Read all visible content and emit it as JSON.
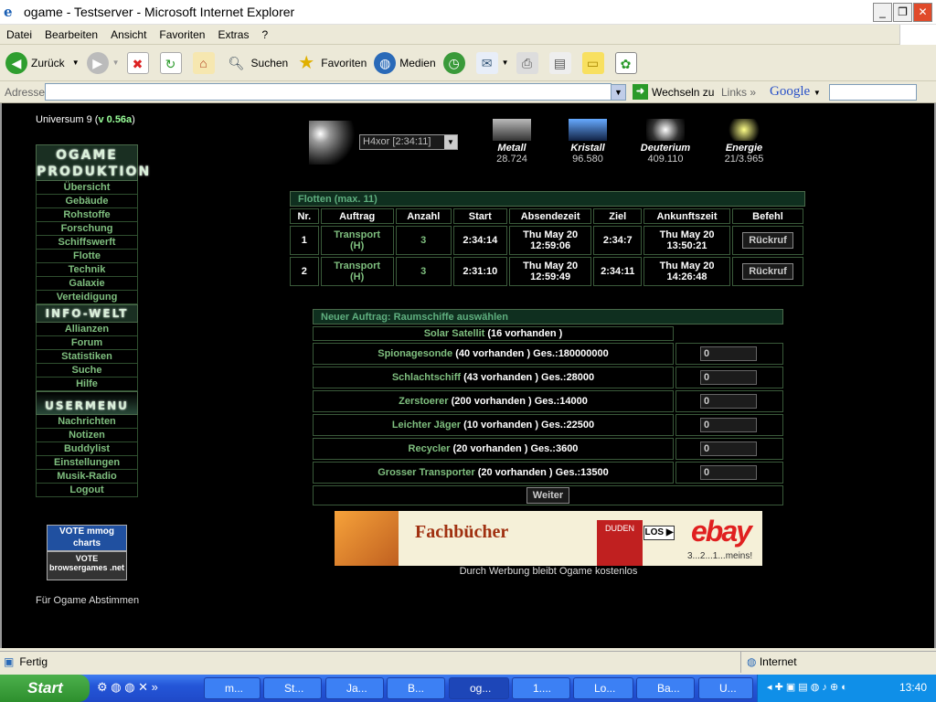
{
  "window": {
    "title": "ogame - Testserver - Microsoft Internet Explorer"
  },
  "menu": [
    "Datei",
    "Bearbeiten",
    "Ansicht",
    "Favoriten",
    "Extras",
    "?"
  ],
  "toolbar": {
    "back": "Zurück",
    "search": "Suchen",
    "favorites": "Favoriten",
    "media": "Medien"
  },
  "address": {
    "label": "Adresse",
    "value": "",
    "go": "Wechseln zu",
    "links": "Links",
    "google": "Google"
  },
  "status": {
    "text": "Fertig",
    "zone": "Internet"
  },
  "taskbar": {
    "start": "Start",
    "items": [
      "m...",
      "St...",
      "Ja...",
      "B...",
      "og...",
      "1....",
      "Lo...",
      "Ba...",
      "U..."
    ],
    "clock": "13:40"
  },
  "game": {
    "universe": "Universum 9 (",
    "version": "v 0.56a",
    "universe_close": ")",
    "banners": {
      "prod": "OGAME PRODUKTION",
      "info": "INFO-WELT",
      "user": "USERMENU"
    },
    "menu_prod": [
      "Übersicht",
      "Gebäude",
      "Rohstoffe",
      "Forschung",
      "Schiffswerft",
      "Flotte",
      "Technik",
      "Galaxie",
      "Verteidigung"
    ],
    "menu_info": [
      "Allianzen",
      "Forum",
      "Statistiken",
      "Suche",
      "Hilfe"
    ],
    "menu_user": [
      "Nachrichten",
      "Notizen",
      "Buddylist",
      "Einstellungen",
      "Musik-Radio",
      "Logout"
    ],
    "vote1": "VOTE mmog charts",
    "vote2": "VOTE browsergames .net",
    "vote_caption": "Für Ogame Abstimmen",
    "planet_select": "H4xor [2:34:11]",
    "resources": [
      {
        "name": "Metall",
        "value": "28.724"
      },
      {
        "name": "Kristall",
        "value": "96.580"
      },
      {
        "name": "Deuterium",
        "value": "409.110"
      },
      {
        "name": "Energie",
        "value": "21/3.965"
      }
    ],
    "fleet_header": "Flotten (max. 11)",
    "fleet_columns": [
      "Nr.",
      "Auftrag",
      "Anzahl",
      "Start",
      "Absendezeit",
      "Ziel",
      "Ankunftszeit",
      "Befehl"
    ],
    "fleets": [
      {
        "nr": "1",
        "mission": "Transport",
        "mission2": "(H)",
        "count": "3",
        "start": "2:34:14",
        "sent": "Thu May 20",
        "sent2": "12:59:06",
        "target": "2:34:7",
        "arrival": "Thu May 20",
        "arrival2": "13:50:21",
        "action": "Rückruf"
      },
      {
        "nr": "2",
        "mission": "Transport",
        "mission2": "(H)",
        "count": "3",
        "start": "2:31:10",
        "sent": "Thu May 20",
        "sent2": "12:59:49",
        "target": "2:34:11",
        "arrival": "Thu May 20",
        "arrival2": "14:26:48",
        "action": "Rückruf"
      }
    ],
    "new_order_header": "Neuer Auftrag: Raumschiffe auswählen",
    "ships": [
      {
        "name": "Solar Satellit",
        "info": "(16 vorhanden )",
        "value": ""
      },
      {
        "name": "Spionagesonde",
        "info": "(40 vorhanden ) Ges.:180000000",
        "value": "0"
      },
      {
        "name": "Schlachtschiff",
        "info": "(43 vorhanden ) Ges.:28000",
        "value": "0"
      },
      {
        "name": "Zerstoerer",
        "info": "(200 vorhanden ) Ges.:14000",
        "value": "0"
      },
      {
        "name": "Leichter Jäger",
        "info": "(10 vorhanden ) Ges.:22500",
        "value": "0"
      },
      {
        "name": "Recycler",
        "info": "(20 vorhanden ) Ges.:3600",
        "value": "0"
      },
      {
        "name": "Grosser Transporter",
        "info": "(20 vorhanden ) Ges.:13500",
        "value": "0"
      }
    ],
    "continue": "Weiter",
    "ad": {
      "text": "Fachbücher",
      "duden": "DUDEN",
      "los": "LOS",
      "ebay": "ebay",
      "slogan": "3...2...1...meins!"
    },
    "ad_caption": "Durch Werbung bleibt Ogame kostenlos"
  }
}
